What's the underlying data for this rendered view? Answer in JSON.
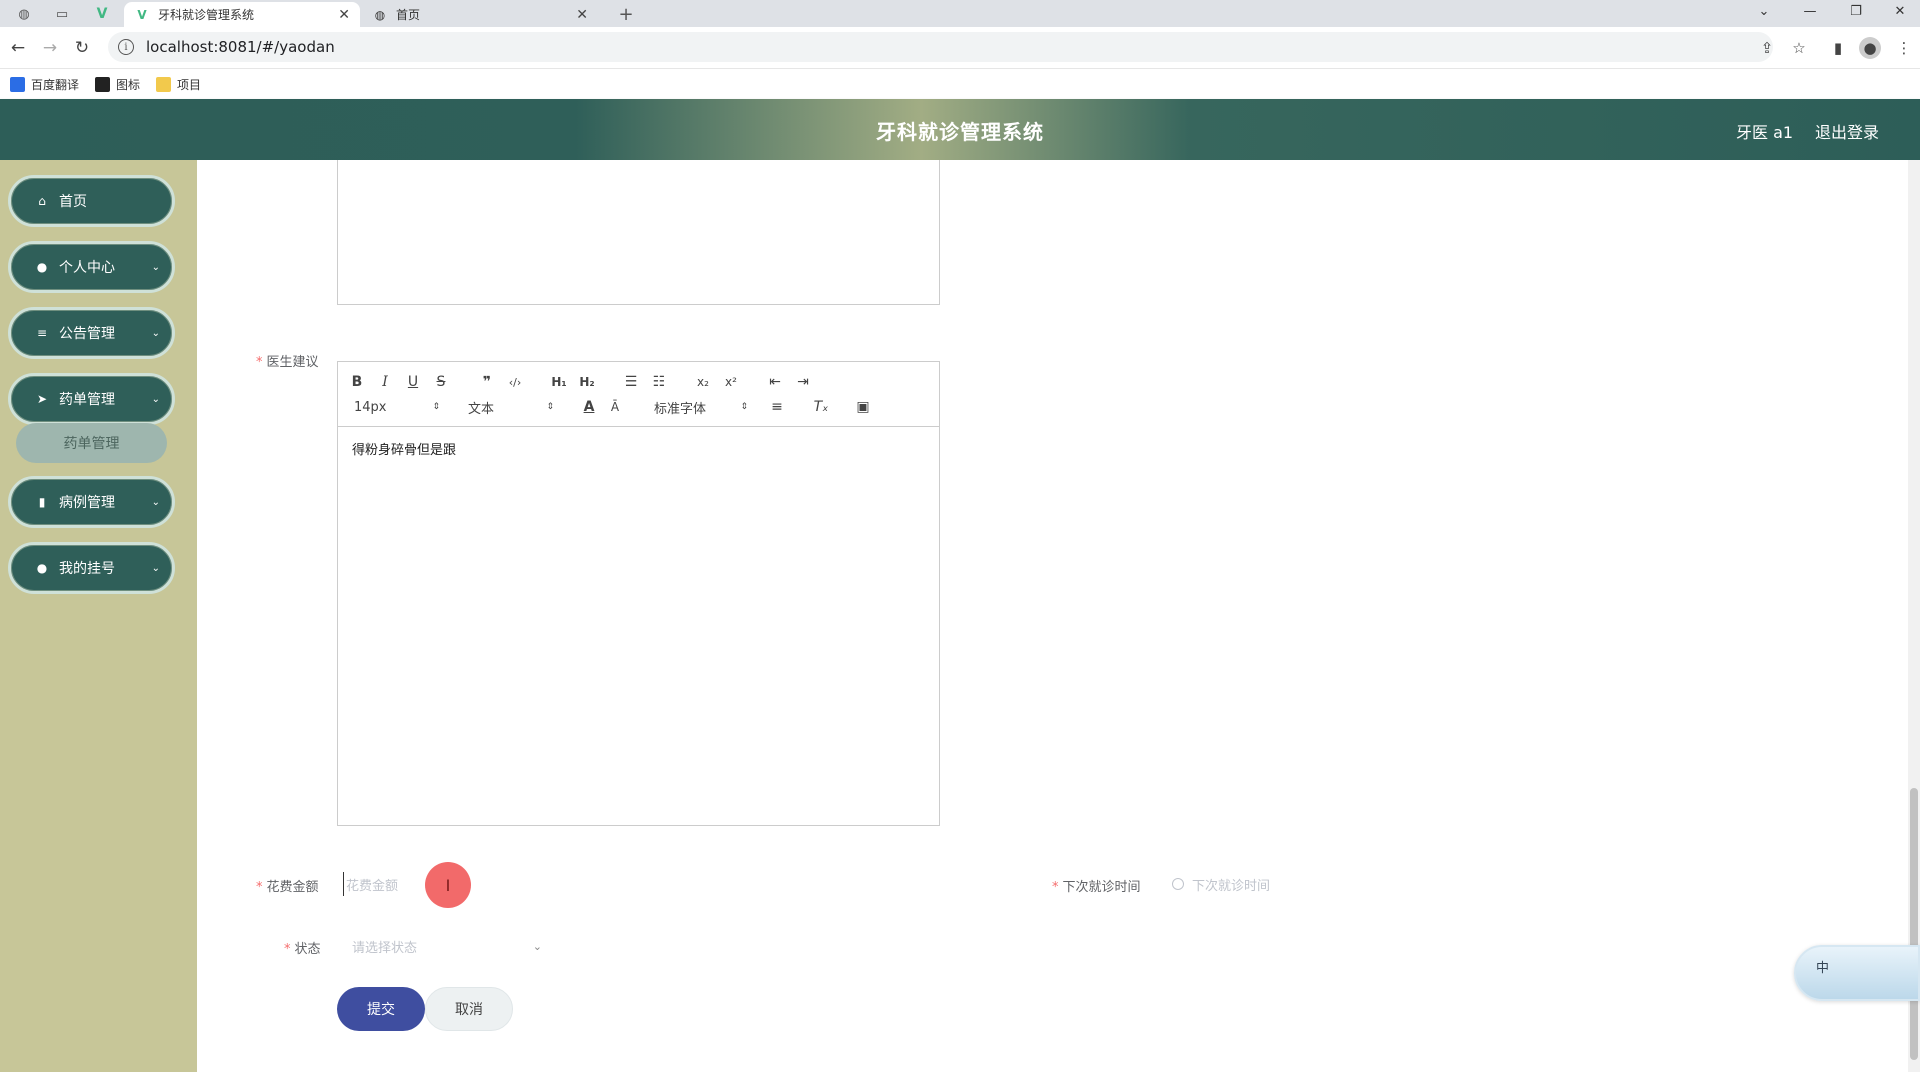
{
  "browser": {
    "tabs": [
      {
        "title": "牙科就诊管理系统",
        "active": true
      },
      {
        "title": "首页",
        "active": false
      }
    ],
    "new_tab_symbol": "+",
    "url": "localhost:8081/#/yaodan",
    "bookmarks": [
      {
        "label": "百度翻译",
        "icon": "translate-icon",
        "color": "#2b6de5"
      },
      {
        "label": "图标",
        "icon": "image-icon",
        "color": "#222222"
      },
      {
        "label": "项目",
        "icon": "folder-icon",
        "color": "#f2c94c"
      }
    ]
  },
  "header": {
    "title": "牙科就诊管理系统",
    "user": "牙医 a1",
    "logout": "退出登录"
  },
  "sidebar": {
    "items": [
      {
        "label": "首页",
        "icon": "home-icon",
        "has_children": false
      },
      {
        "label": "个人中心",
        "icon": "user-icon",
        "has_children": true
      },
      {
        "label": "公告管理",
        "icon": "list-icon",
        "has_children": true
      },
      {
        "label": "药单管理",
        "icon": "send-icon",
        "has_children": true
      },
      {
        "label": "病例管理",
        "icon": "bar-chart-icon",
        "has_children": true
      },
      {
        "label": "我的挂号",
        "icon": "location-pin-icon",
        "has_children": true
      }
    ],
    "submenu": {
      "label": "药单管理"
    }
  },
  "form": {
    "advice": {
      "label": "医生建议",
      "toolbar": {
        "size": "14px",
        "header": "文本",
        "font": "标准字体"
      },
      "content": "得粉身碎骨但是跟"
    },
    "cost": {
      "label": "花费金额",
      "placeholder": "花费金额"
    },
    "next_visit": {
      "label": "下次就诊时间",
      "placeholder": "下次就诊时间"
    },
    "status": {
      "label": "状态",
      "placeholder": "请选择状态"
    },
    "submit": "提交",
    "cancel": "取消"
  },
  "ime": {
    "label": "中"
  },
  "colors": {
    "header_primary": "#2d5e58",
    "sidebar_bg": "#c7c698",
    "menu_bg": "#2f5f59",
    "submit_bg": "#3f4ea0",
    "required": "#f56c6c"
  }
}
